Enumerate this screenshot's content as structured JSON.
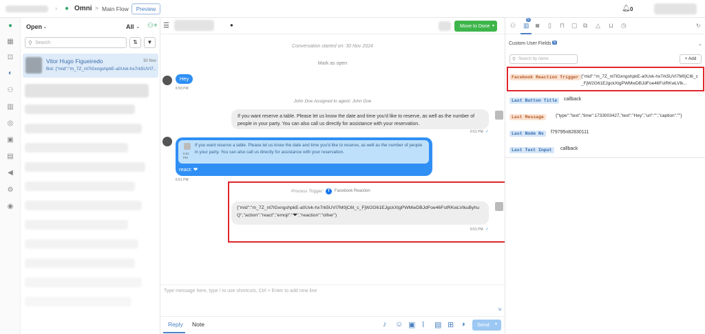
{
  "topbar": {
    "workspace": "Omni",
    "separator": ">",
    "flow": "Main Flow",
    "preview_label": "Preview",
    "notif_count": "0"
  },
  "convlist": {
    "status_filter": "Open",
    "all_filter": "All",
    "search_placeholder": "Search",
    "active": {
      "name": "Vitor Hugo Figueiredo",
      "date": "30 Nov",
      "preview": "Bot: {\"mid\":\"m_7Z_nt7lGxngshpkE-a0Uvk-hx7rk5UVI7..."
    }
  },
  "chat": {
    "move_to_done": "Move to Done",
    "started": "Conversation started on: 30 Nov 2024",
    "mark_open": "Mark as open",
    "hey": "Hey",
    "hey_time": "6:50 PM",
    "assigned": "John Doe Assigned to agent: John Doe",
    "bot_msg": "If you want reserve a table. Please let us know the date and time you'd like to reserve, as well as the number of people in your party. You can also call us directly for assistance with your reservation.",
    "bot_time": "6:51 PM",
    "quoted_time": "6:51 PM",
    "react_text": "react: ❤",
    "react_time": "6:51 PM",
    "trigger_label": "Process Trigger:",
    "trigger_name": "Facebook Reaction",
    "payload": "{\"mid\":\"m_7Z_nt7lGxngshpkE-a0Uvk-hx7rk5UVI7M0jC6t_c_FjW2G61EJgckXtgPWMwDBJdFoe46FstRKwLVlkuByhuQ\",\"action\":\"react\",\"emoji\":\"❤\",\"reaction\":\"other\")",
    "payload_time": "6:51 PM",
    "input_placeholder": "Type message here, type / to use shortcuts, Ctrl + Enter to add new line",
    "reply_tab": "Reply",
    "note_tab": "Note",
    "send_label": "Send"
  },
  "rpanel": {
    "badge": "5",
    "section_title": "Custom User Fields",
    "section_count": "5",
    "search_placeholder": "Search by name",
    "add_label": "+ Add",
    "fields": [
      {
        "tag": "Facebook Reaction Trigger",
        "value": "{\"mid\":\"m_7Z_nt7lGxngshpkE-a0Uvk-hx7rk5UVI7M0jC6t_c_FjW2G61EJgckXtgPWMwDBJdFoe46FstRKwLVlk...",
        "bg": "#fbe3d3",
        "fg": "#b55c2a"
      },
      {
        "tag": "Last Button Title",
        "value": "callback",
        "bg": "#d6e6f7",
        "fg": "#2f6bb0"
      },
      {
        "tag": "Last Message",
        "value": "{\"type\":\"text\",\"time\":1733003427,\"text\":\"Hey\",\"url\":\"\",\"caption\":\"\"}",
        "bg": "#fbe3d3",
        "fg": "#b55c2a"
      },
      {
        "tag": "Last Node Ns",
        "value": "f79795n82830111",
        "bg": "#d6e6f7",
        "fg": "#2f6bb0"
      },
      {
        "tag": "Last Text Input",
        "value": "callback",
        "bg": "#d6e6f7",
        "fg": "#2f6bb0"
      }
    ]
  }
}
